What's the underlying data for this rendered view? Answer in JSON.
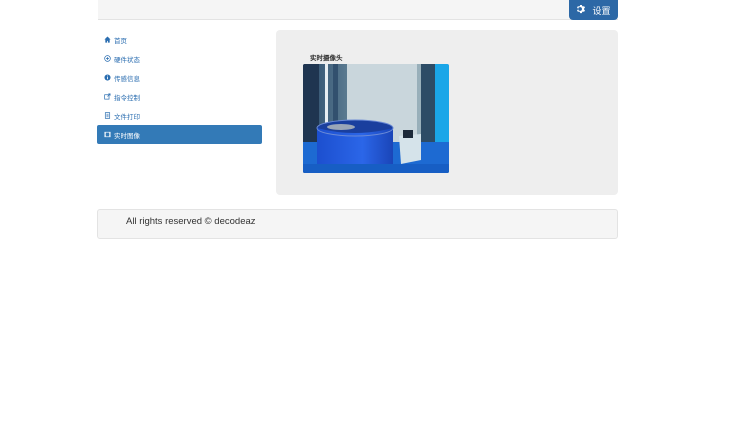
{
  "header": {
    "settings_label": "设置",
    "settings_icon": "gear-icon"
  },
  "sidebar": {
    "items": [
      {
        "label": "首页",
        "icon": "home-icon"
      },
      {
        "label": "硬件状态",
        "icon": "plus-circle-icon"
      },
      {
        "label": "传感信息",
        "icon": "info-circle-icon"
      },
      {
        "label": "指令控制",
        "icon": "share-icon"
      },
      {
        "label": "文件打印",
        "icon": "file-icon"
      },
      {
        "label": "实时图像",
        "icon": "film-icon",
        "active": true
      }
    ]
  },
  "main": {
    "camera_title": "实时摄像头"
  },
  "footer": {
    "text": "All rights reserved © decodeaz"
  },
  "colors": {
    "accent": "#337ab7",
    "settings_button": "#2c68a6",
    "link": "#2a6db0",
    "panel_bg": "#eeeeee"
  }
}
